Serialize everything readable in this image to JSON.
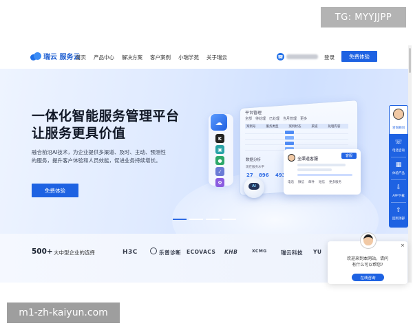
{
  "watermark_top": "TG: MYYJJPP",
  "watermark_bottom": "m1-zh-kaiyun.com",
  "brand": {
    "name": "瑞云 服务云"
  },
  "nav": {
    "items": [
      "首页",
      "产品中心",
      "解决方案",
      "客户案例",
      "小瑞学苑",
      "关于瑞云"
    ],
    "login": "登录",
    "trial": "免费体验"
  },
  "hero": {
    "title_line1": "一体化智能服务管理平台",
    "title_line2": "让服务更具价值",
    "desc_line1": "融合前沿AI技术，为企业提供多渠道、及时、主动、预测性",
    "desc_line2": "的服务，提升客户体验和人员效能，促进业务持续增长。",
    "button": "免费体验"
  },
  "illustration": {
    "panel_title": "平台管理",
    "tabs": [
      "全部",
      "待处理",
      "已处理",
      "当月管理",
      "更多"
    ],
    "columns": [
      "案例号",
      "服务类型",
      "案例状态",
      "渠道",
      "处理内容"
    ],
    "stat_title": "数据分析",
    "stat_sub": "现在服务水平",
    "numbers": [
      "27",
      "896",
      "493"
    ],
    "robot_label": "AI",
    "chat_name": "全渠道客服",
    "chat_tag": "客服",
    "chat_actions": [
      "电话",
      "微信",
      "邮件",
      "短信",
      "更多服务"
    ]
  },
  "float_bar": {
    "items": [
      "咨询顾问",
      "电话咨询",
      "体验产品",
      "APP下载",
      "回到顶部"
    ],
    "icons": [
      "phone-icon",
      "grid-icon",
      "download-icon",
      "top-icon"
    ]
  },
  "clients": {
    "count": "500+",
    "label": "大中型企业的选择",
    "brands": [
      "H3C",
      "乐普诊断",
      "ECOVACS",
      "KHB",
      "XCMG",
      "瑞云科技",
      "YU"
    ]
  },
  "popup": {
    "line1": "欢迎来到本网站，请问",
    "line2": "有什么可以帮您?",
    "button": "在线咨询",
    "close": "×"
  },
  "colors": {
    "primary": "#1e62e2",
    "hero_bg": "#dfeaff"
  }
}
